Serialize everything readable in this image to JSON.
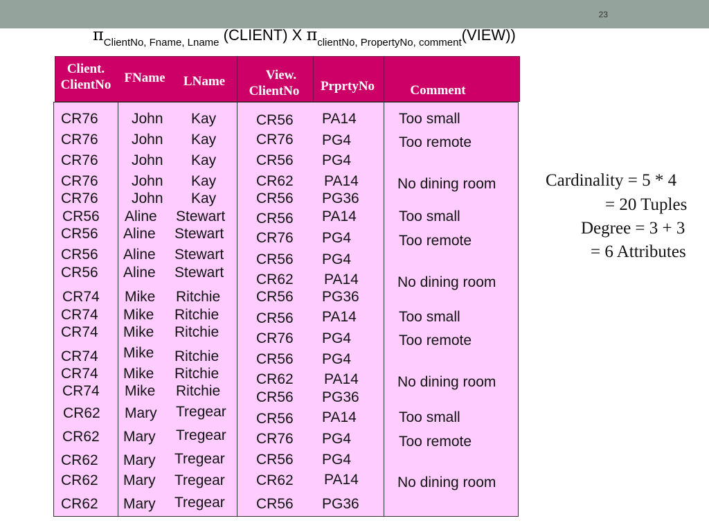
{
  "slide_number": "23",
  "formula": {
    "pi1": "π",
    "sub1": "ClientNo, Fname, Lname",
    "mid": " (CLIENT) X ",
    "pi2": "π",
    "sub2": "clientNo, PropertyNo, comment",
    "end": "(VIEW))"
  },
  "headers": {
    "client_clientno_1": "Client.",
    "client_clientno_2": "ClientNo",
    "fname": "FName",
    "lname": "LName",
    "view_clientno_1": "View.",
    "view_clientno_2": "ClientNo",
    "prprtyno": "PrprtyNo",
    "comment": "Comment"
  },
  "rows": [
    [
      "CR76",
      "John",
      "Kay",
      "CR56",
      "PA14",
      "Too small"
    ],
    [
      "CR76",
      "John",
      "Kay",
      "CR76",
      "PG4",
      "Too remote"
    ],
    [
      "CR76",
      "John",
      "Kay",
      "CR56",
      "PG4",
      ""
    ],
    [
      "CR76",
      "John",
      "Kay",
      "CR62",
      "PA14",
      "No dining room"
    ],
    [
      "CR76",
      "John",
      "Kay",
      "CR56",
      "PG36",
      ""
    ],
    [
      "CR56",
      "Aline",
      "Stewart",
      "CR56",
      "PA14",
      "Too small"
    ],
    [
      "CR56",
      "Aline",
      "Stewart",
      "CR76",
      "PG4",
      "Too remote"
    ],
    [
      "CR56",
      "Aline",
      "Stewart",
      "CR56",
      "PG4",
      ""
    ],
    [
      "CR56",
      "Aline",
      "Stewart",
      "CR62",
      "PA14",
      "No dining room"
    ],
    [
      "CR74",
      "Mike",
      "Ritchie",
      "CR56",
      "PG36",
      ""
    ],
    [
      "CR74",
      "Mike",
      "Ritchie",
      "CR56",
      "PA14",
      "Too small"
    ],
    [
      "CR74",
      "Mike",
      "Ritchie",
      "CR76",
      "PG4",
      "Too remote"
    ],
    [
      "CR74",
      "Mike",
      "Ritchie",
      "CR56",
      "PG4",
      ""
    ],
    [
      "CR74",
      "Mike",
      "Ritchie",
      "CR62",
      "PA14",
      "No dining room"
    ],
    [
      "CR74",
      "Mike",
      "Ritchie",
      "CR56",
      "PG36",
      ""
    ],
    [
      "CR62",
      "Mary",
      "Tregear",
      "CR56",
      "PA14",
      "Too small"
    ],
    [
      "CR62",
      "Mary",
      "Tregear",
      "CR76",
      "PG4",
      "Too remote"
    ],
    [
      "CR62",
      "Mary",
      "Tregear",
      "CR56",
      "PG4",
      ""
    ],
    [
      "CR62",
      "Mary",
      "Tregear",
      "CR62",
      "PA14",
      "No dining room"
    ],
    [
      "CR62",
      "Mary",
      "Tregear",
      "CR56",
      "PG36",
      ""
    ]
  ],
  "side_text": {
    "line1": "Cardinality = 5 * 4",
    "line2": "= 20 Tuples",
    "line3": "Degree = 3 + 3",
    "line4": "= 6 Attributes"
  }
}
